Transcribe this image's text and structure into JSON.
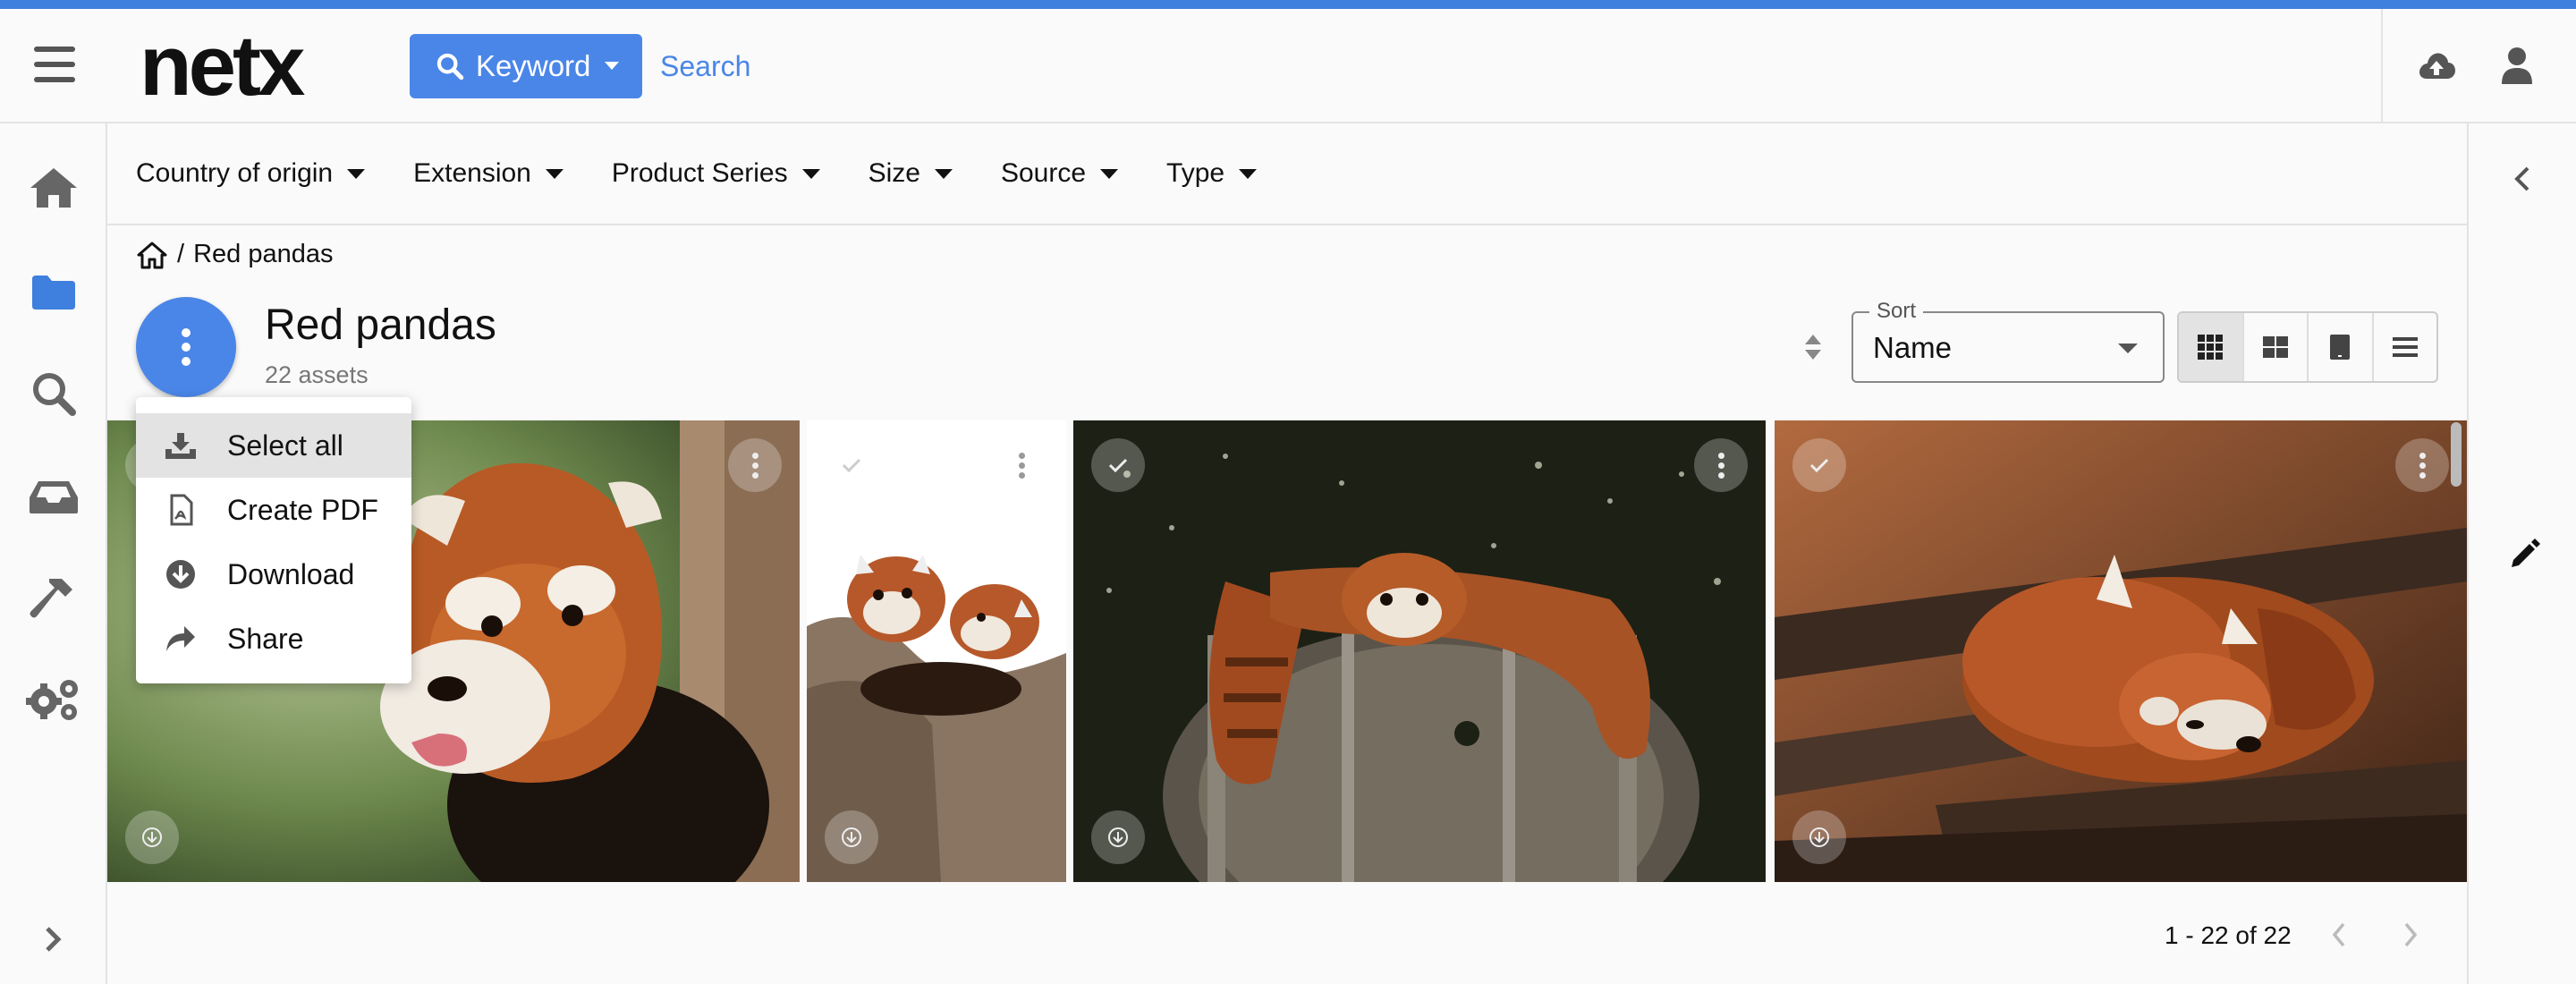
{
  "header": {
    "logo": "netx",
    "keyword_button": "Keyword",
    "search_placeholder": "Search"
  },
  "filters": [
    "Country of origin",
    "Extension",
    "Product Series",
    "Size",
    "Source",
    "Type"
  ],
  "breadcrumb": {
    "current": "Red pandas"
  },
  "folder": {
    "title": "Red pandas",
    "count": "22 assets"
  },
  "sort": {
    "label": "Sort",
    "value": "Name"
  },
  "context_menu": {
    "items": [
      "Select all",
      "Create PDF",
      "Download",
      "Share"
    ]
  },
  "pagination": {
    "range": "1 - 22 of 22"
  },
  "colors": {
    "accent": "#4a86e8",
    "top_bar": "#3f7fdd"
  }
}
